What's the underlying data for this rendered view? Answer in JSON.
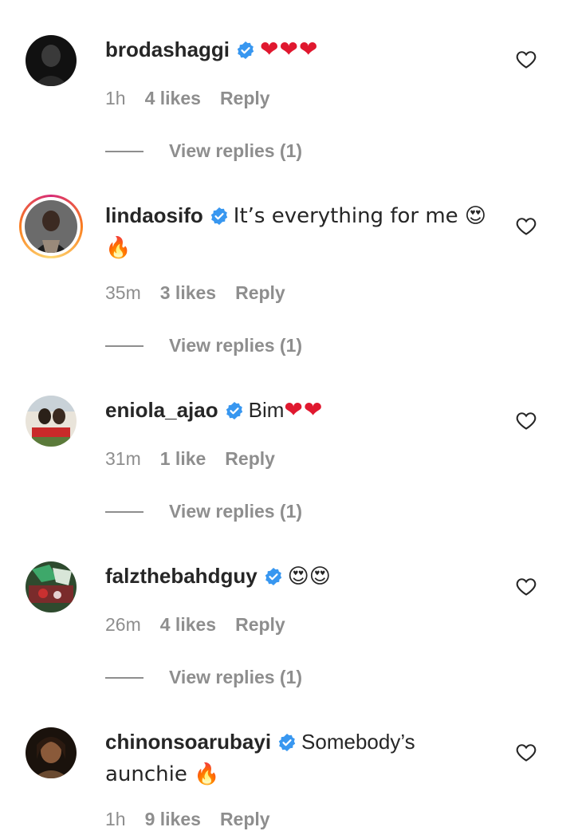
{
  "comments": [
    {
      "username": "brodashaggi",
      "text": "❤❤❤",
      "time": "1h",
      "likes": "4 likes",
      "reply": "Reply",
      "view_replies": "View replies (1)"
    },
    {
      "username": "lindaosifo",
      "text": "It’s everything for me 😍",
      "text_line2": "🔥",
      "time": "35m",
      "likes": "3 likes",
      "reply": "Reply",
      "view_replies": "View replies (1)"
    },
    {
      "username": "eniola_ajao",
      "text": "Bim",
      "text_hearts": "❤❤",
      "time": "31m",
      "likes": "1 like",
      "reply": "Reply",
      "view_replies": "View replies (1)"
    },
    {
      "username": "falzthebahdguy",
      "text": "😍😍",
      "time": "26m",
      "likes": "4 likes",
      "reply": "Reply",
      "view_replies": "View replies (1)"
    },
    {
      "username": "chinonsoarubayi",
      "text": "Somebody’s",
      "text_line2": "aunchie 🔥",
      "time": "1h",
      "likes": "9 likes",
      "reply": "Reply"
    }
  ],
  "icons": {
    "verified": "verified-badge-icon",
    "like": "heart-outline-icon"
  },
  "colors": {
    "verified_blue": "#3897f0",
    "muted_gray": "#8e8e8e",
    "text_dark": "#262626",
    "heart_red": "#e0182f"
  }
}
